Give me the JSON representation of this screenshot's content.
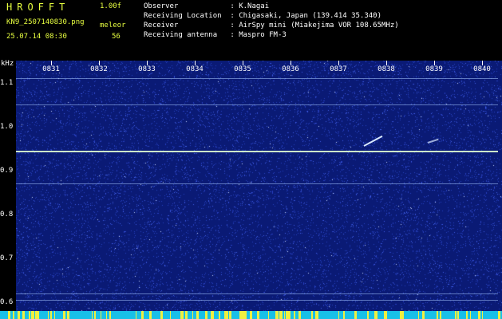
{
  "header": {
    "app_title": "HROFFT",
    "version": "1.00f",
    "filename": "KN9_2507140830.png",
    "datetime": "25.07.14 08:30",
    "meteor_label": "meleor",
    "meteor_count": "56",
    "info_lines": [
      "Observer            : K.Nagai",
      "Receiving Location  : Chigasaki, Japan (139.414 35.340)",
      "Receiver            : AirSpy mini (Miakejima VOR 108.65MHz)",
      "Receiving antenna   : Maspro FM-3"
    ]
  },
  "chart_data": {
    "type": "heatmap",
    "yunit": "kHz",
    "x_ticks": [
      "0831",
      "0832",
      "0833",
      "0834",
      "0835",
      "0836",
      "0837",
      "0838",
      "0839",
      "0840"
    ],
    "y_ticks": [
      "1.1",
      "1.0",
      "0.9",
      "0.8",
      "0.7",
      "0.6"
    ],
    "ylim": [
      0.58,
      1.15
    ],
    "horizontal_lines_khz": [
      1.11,
      1.05,
      0.945,
      0.87,
      0.62,
      0.605
    ],
    "colors": {
      "background": "#0a1a75",
      "noise": "#5a78ff",
      "lines": "#a8c8ff",
      "axis_text": "#ffffff",
      "header_title": "#e8ff40",
      "bottom_bar": "#18c0e8"
    }
  }
}
